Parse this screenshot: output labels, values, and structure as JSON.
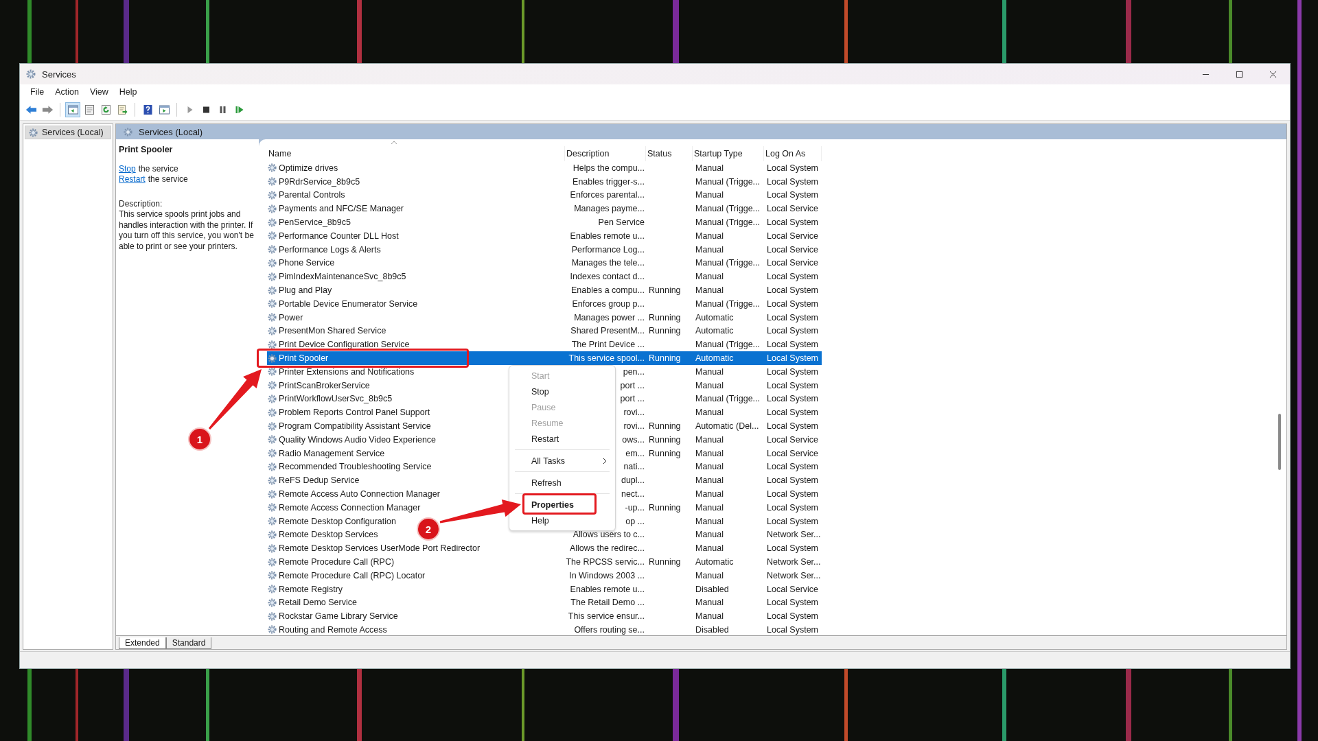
{
  "window": {
    "title": "Services"
  },
  "menu_bar": [
    "File",
    "Action",
    "View",
    "Help"
  ],
  "toolbar_groups": [
    [
      {
        "kind": "back",
        "pressed": false
      },
      {
        "kind": "forward",
        "pressed": false
      }
    ],
    [
      {
        "kind": "tree",
        "pressed": true
      },
      {
        "kind": "sheet",
        "pressed": false
      },
      {
        "kind": "refresh",
        "pressed": false
      },
      {
        "kind": "export",
        "pressed": false
      }
    ],
    [
      {
        "kind": "help",
        "pressed": false
      },
      {
        "kind": "console",
        "pressed": false
      }
    ],
    [
      {
        "kind": "play",
        "pressed": false
      },
      {
        "kind": "stop",
        "pressed": false
      },
      {
        "kind": "pause",
        "pressed": false
      },
      {
        "kind": "resume",
        "pressed": false
      }
    ]
  ],
  "tree": {
    "items": [
      {
        "label": "Services (Local)",
        "selected": true
      }
    ]
  },
  "header": {
    "title": "Services (Local)"
  },
  "details": {
    "title": "Print Spooler",
    "actions": [
      {
        "link": "Stop",
        "text": "the service"
      },
      {
        "link": "Restart",
        "text": "the service"
      }
    ],
    "description_label": "Description:",
    "description": "This service spools print jobs and handles interaction with the printer. If you turn off this service, you won't be able to print or see your printers."
  },
  "table": {
    "columns": [
      "Name",
      "Description",
      "Status",
      "Startup Type",
      "Log On As"
    ],
    "rows": [
      {
        "name": "Optimize drives",
        "description": "Helps the compu...",
        "status": "",
        "startup_type": "Manual",
        "log_on_as": "Local System",
        "selected": false
      },
      {
        "name": "P9RdrService_8b9c5",
        "description": "Enables trigger-s...",
        "status": "",
        "startup_type": "Manual (Trigge...",
        "log_on_as": "Local System",
        "selected": false
      },
      {
        "name": "Parental Controls",
        "description": "Enforces parental...",
        "status": "",
        "startup_type": "Manual",
        "log_on_as": "Local System",
        "selected": false
      },
      {
        "name": "Payments and NFC/SE Manager",
        "description": "Manages payme...",
        "status": "",
        "startup_type": "Manual (Trigge...",
        "log_on_as": "Local Service",
        "selected": false
      },
      {
        "name": "PenService_8b9c5",
        "description": "Pen Service",
        "status": "",
        "startup_type": "Manual (Trigge...",
        "log_on_as": "Local System",
        "selected": false
      },
      {
        "name": "Performance Counter DLL Host",
        "description": "Enables remote u...",
        "status": "",
        "startup_type": "Manual",
        "log_on_as": "Local Service",
        "selected": false
      },
      {
        "name": "Performance Logs & Alerts",
        "description": "Performance Log...",
        "status": "",
        "startup_type": "Manual",
        "log_on_as": "Local Service",
        "selected": false
      },
      {
        "name": "Phone Service",
        "description": "Manages the tele...",
        "status": "",
        "startup_type": "Manual (Trigge...",
        "log_on_as": "Local Service",
        "selected": false
      },
      {
        "name": "PimIndexMaintenanceSvc_8b9c5",
        "description": "Indexes contact d...",
        "status": "",
        "startup_type": "Manual",
        "log_on_as": "Local System",
        "selected": false
      },
      {
        "name": "Plug and Play",
        "description": "Enables a compu...",
        "status": "Running",
        "startup_type": "Manual",
        "log_on_as": "Local System",
        "selected": false
      },
      {
        "name": "Portable Device Enumerator Service",
        "description": "Enforces group p...",
        "status": "",
        "startup_type": "Manual (Trigge...",
        "log_on_as": "Local System",
        "selected": false
      },
      {
        "name": "Power",
        "description": "Manages power ...",
        "status": "Running",
        "startup_type": "Automatic",
        "log_on_as": "Local System",
        "selected": false
      },
      {
        "name": "PresentMon Shared Service",
        "description": "Shared PresentM...",
        "status": "Running",
        "startup_type": "Automatic",
        "log_on_as": "Local System",
        "selected": false
      },
      {
        "name": "Print Device Configuration Service",
        "description": "The Print Device ...",
        "status": "",
        "startup_type": "Manual (Trigge...",
        "log_on_as": "Local System",
        "selected": false
      },
      {
        "name": "Print Spooler",
        "description": "This service spool...",
        "status": "Running",
        "startup_type": "Automatic",
        "log_on_as": "Local System",
        "selected": true
      },
      {
        "name": "Printer Extensions and Notifications",
        "description": "pen...",
        "status": "",
        "startup_type": "Manual",
        "log_on_as": "Local System",
        "selected": false
      },
      {
        "name": "PrintScanBrokerService",
        "description": "port ...",
        "status": "",
        "startup_type": "Manual",
        "log_on_as": "Local System",
        "selected": false
      },
      {
        "name": "PrintWorkflowUserSvc_8b9c5",
        "description": "port ...",
        "status": "",
        "startup_type": "Manual (Trigge...",
        "log_on_as": "Local System",
        "selected": false
      },
      {
        "name": "Problem Reports Control Panel Support",
        "description": "rovi...",
        "status": "",
        "startup_type": "Manual",
        "log_on_as": "Local System",
        "selected": false
      },
      {
        "name": "Program Compatibility Assistant Service",
        "description": "rovi...",
        "status": "Running",
        "startup_type": "Automatic (Del...",
        "log_on_as": "Local System",
        "selected": false
      },
      {
        "name": "Quality Windows Audio Video Experience",
        "description": "ows...",
        "status": "Running",
        "startup_type": "Manual",
        "log_on_as": "Local Service",
        "selected": false
      },
      {
        "name": "Radio Management Service",
        "description": "em...",
        "status": "Running",
        "startup_type": "Manual",
        "log_on_as": "Local Service",
        "selected": false
      },
      {
        "name": "Recommended Troubleshooting Service",
        "description": "nati...",
        "status": "",
        "startup_type": "Manual",
        "log_on_as": "Local System",
        "selected": false
      },
      {
        "name": "ReFS Dedup Service",
        "description": "dupl...",
        "status": "",
        "startup_type": "Manual",
        "log_on_as": "Local System",
        "selected": false
      },
      {
        "name": "Remote Access Auto Connection Manager",
        "description": "nect...",
        "status": "",
        "startup_type": "Manual",
        "log_on_as": "Local System",
        "selected": false
      },
      {
        "name": "Remote Access Connection Manager",
        "description": "-up...",
        "status": "Running",
        "startup_type": "Manual",
        "log_on_as": "Local System",
        "selected": false
      },
      {
        "name": "Remote Desktop Configuration",
        "description": "op ...",
        "status": "",
        "startup_type": "Manual",
        "log_on_as": "Local System",
        "selected": false
      },
      {
        "name": "Remote Desktop Services",
        "description": "Allows users to c...",
        "status": "",
        "startup_type": "Manual",
        "log_on_as": "Network Ser...",
        "selected": false
      },
      {
        "name": "Remote Desktop Services UserMode Port Redirector",
        "description": "Allows the redirec...",
        "status": "",
        "startup_type": "Manual",
        "log_on_as": "Local System",
        "selected": false
      },
      {
        "name": "Remote Procedure Call (RPC)",
        "description": "The RPCSS servic...",
        "status": "Running",
        "startup_type": "Automatic",
        "log_on_as": "Network Ser...",
        "selected": false
      },
      {
        "name": "Remote Procedure Call (RPC) Locator",
        "description": "In Windows 2003 ...",
        "status": "",
        "startup_type": "Manual",
        "log_on_as": "Network Ser...",
        "selected": false
      },
      {
        "name": "Remote Registry",
        "description": "Enables remote u...",
        "status": "",
        "startup_type": "Disabled",
        "log_on_as": "Local Service",
        "selected": false
      },
      {
        "name": "Retail Demo Service",
        "description": "The Retail Demo ...",
        "status": "",
        "startup_type": "Manual",
        "log_on_as": "Local System",
        "selected": false
      },
      {
        "name": "Rockstar Game Library Service",
        "description": "This service ensur...",
        "status": "",
        "startup_type": "Manual",
        "log_on_as": "Local System",
        "selected": false
      },
      {
        "name": "Routing and Remote Access",
        "description": "Offers routing se...",
        "status": "",
        "startup_type": "Disabled",
        "log_on_as": "Local System",
        "selected": false
      }
    ]
  },
  "context_menu": {
    "items": [
      {
        "kind": "item",
        "label": "Start",
        "disabled": true,
        "default": false,
        "submenu": false
      },
      {
        "kind": "item",
        "label": "Stop",
        "disabled": false,
        "default": false,
        "submenu": false
      },
      {
        "kind": "item",
        "label": "Pause",
        "disabled": true,
        "default": false,
        "submenu": false
      },
      {
        "kind": "item",
        "label": "Resume",
        "disabled": true,
        "default": false,
        "submenu": false
      },
      {
        "kind": "item",
        "label": "Restart",
        "disabled": false,
        "default": false,
        "submenu": false
      },
      {
        "kind": "separator"
      },
      {
        "kind": "item",
        "label": "All Tasks",
        "disabled": false,
        "default": false,
        "submenu": true
      },
      {
        "kind": "separator"
      },
      {
        "kind": "item",
        "label": "Refresh",
        "disabled": false,
        "default": false,
        "submenu": false
      },
      {
        "kind": "separator"
      },
      {
        "kind": "item",
        "label": "Properties",
        "disabled": false,
        "default": true,
        "submenu": false
      },
      {
        "kind": "item",
        "label": "Help",
        "disabled": false,
        "default": false,
        "submenu": false
      }
    ]
  },
  "annotations": [
    {
      "number": "1"
    },
    {
      "number": "2"
    }
  ],
  "view_tabs": [
    {
      "label": "Extended",
      "selected": true
    },
    {
      "label": "Standard",
      "selected": false
    }
  ]
}
